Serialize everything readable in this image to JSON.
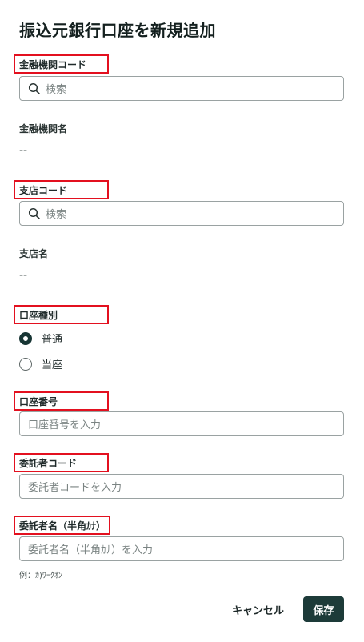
{
  "page": {
    "title": "振込元銀行口座を新規追加"
  },
  "bank_code": {
    "label": "金融機関コード",
    "placeholder": "検索"
  },
  "bank_name": {
    "label": "金融機関名",
    "value": "--"
  },
  "branch_code": {
    "label": "支店コード",
    "placeholder": "検索"
  },
  "branch_name": {
    "label": "支店名",
    "value": "--"
  },
  "account_type": {
    "label": "口座種別",
    "options": [
      {
        "label": "普通",
        "selected": true
      },
      {
        "label": "当座",
        "selected": false
      }
    ]
  },
  "account_number": {
    "label": "口座番号",
    "placeholder": "口座番号を入力"
  },
  "consignor_code": {
    "label": "委託者コード",
    "placeholder": "委託者コードを入力"
  },
  "consignor_name_kana": {
    "label": "委託者名（半角ｶﾅ）",
    "placeholder": "委託者名（半角ｶﾅ）を入力",
    "hint": "例：ｶ)ﾜｰｸｵﾝ"
  },
  "actions": {
    "cancel_label": "キャンセル",
    "save_label": "保存"
  },
  "colors": {
    "highlight": "#e3101f",
    "primary": "#1d3b39",
    "text": "#1f2a2a"
  },
  "icons": {
    "search": "search-icon"
  }
}
